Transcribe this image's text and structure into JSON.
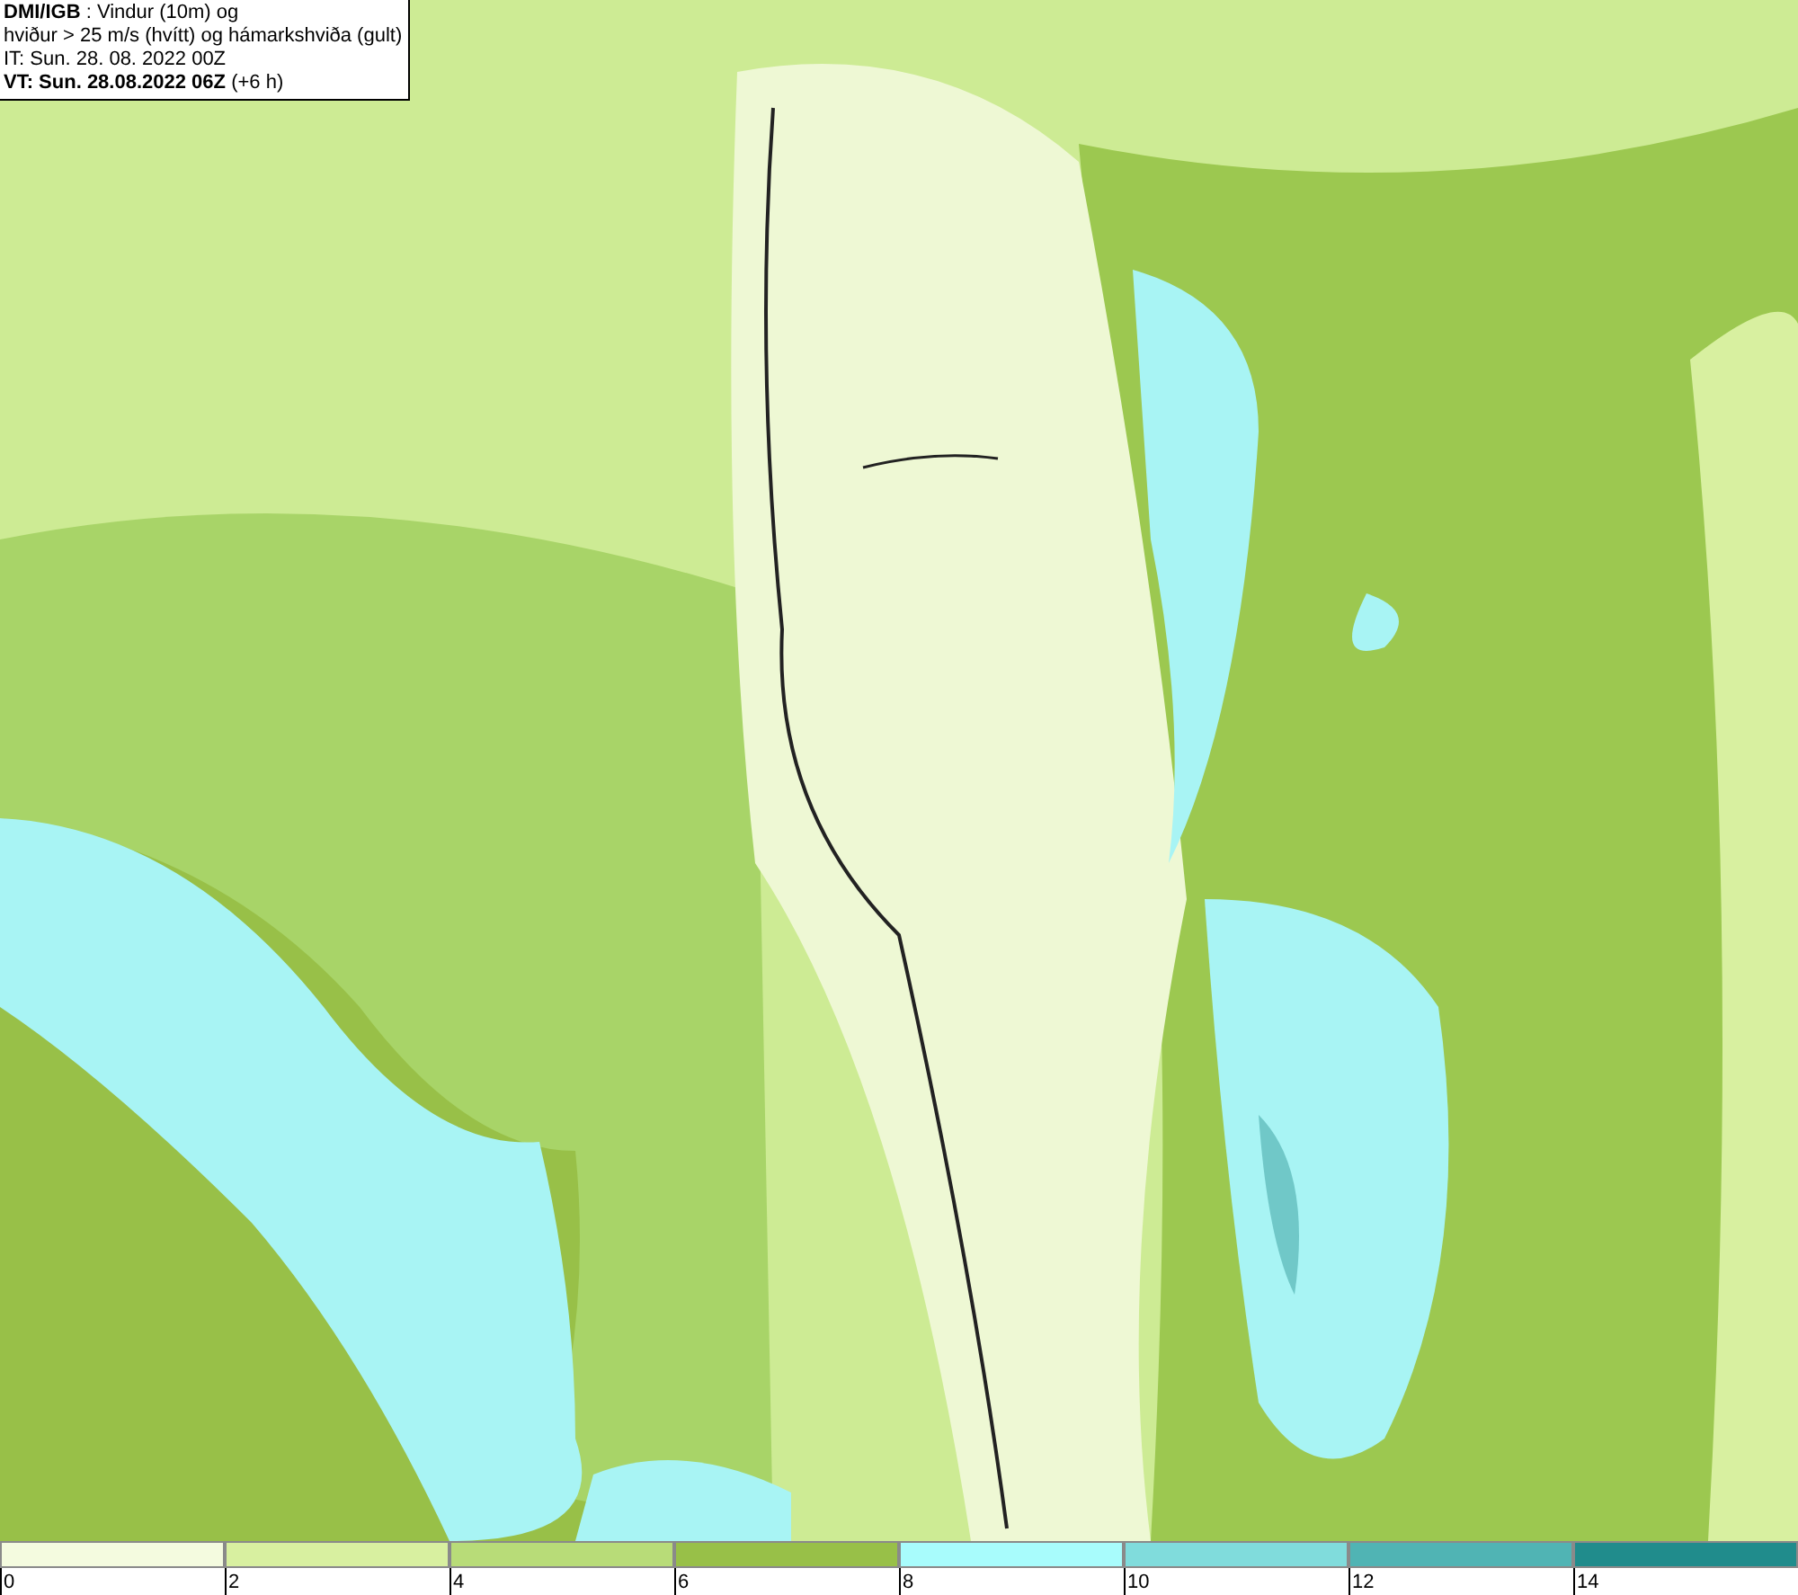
{
  "title_box": {
    "lines": [
      "**DMI/IGB** : Vindur (10m) og",
      "hviður > 25 m/s (hvítt) og hámarkshviða (gult)",
      "IT: Sun. 28. 08. 2022 00Z",
      "**VT: Sun. 28.08.2022 06Z** (+6 h)"
    ]
  },
  "legend": {
    "bins": [
      {
        "color": "#f4fbdf"
      },
      {
        "color": "#d8f0a0"
      },
      {
        "color": "#b8dc78"
      },
      {
        "color": "#98c048"
      },
      {
        "color": "#a8fcfc"
      },
      {
        "color": "#80dcdc"
      },
      {
        "color": "#50b4b4"
      },
      {
        "color": "#208c8c"
      }
    ],
    "ticks": [
      "0",
      "2",
      "4",
      "6",
      "8",
      "10",
      "12",
      "14"
    ]
  }
}
